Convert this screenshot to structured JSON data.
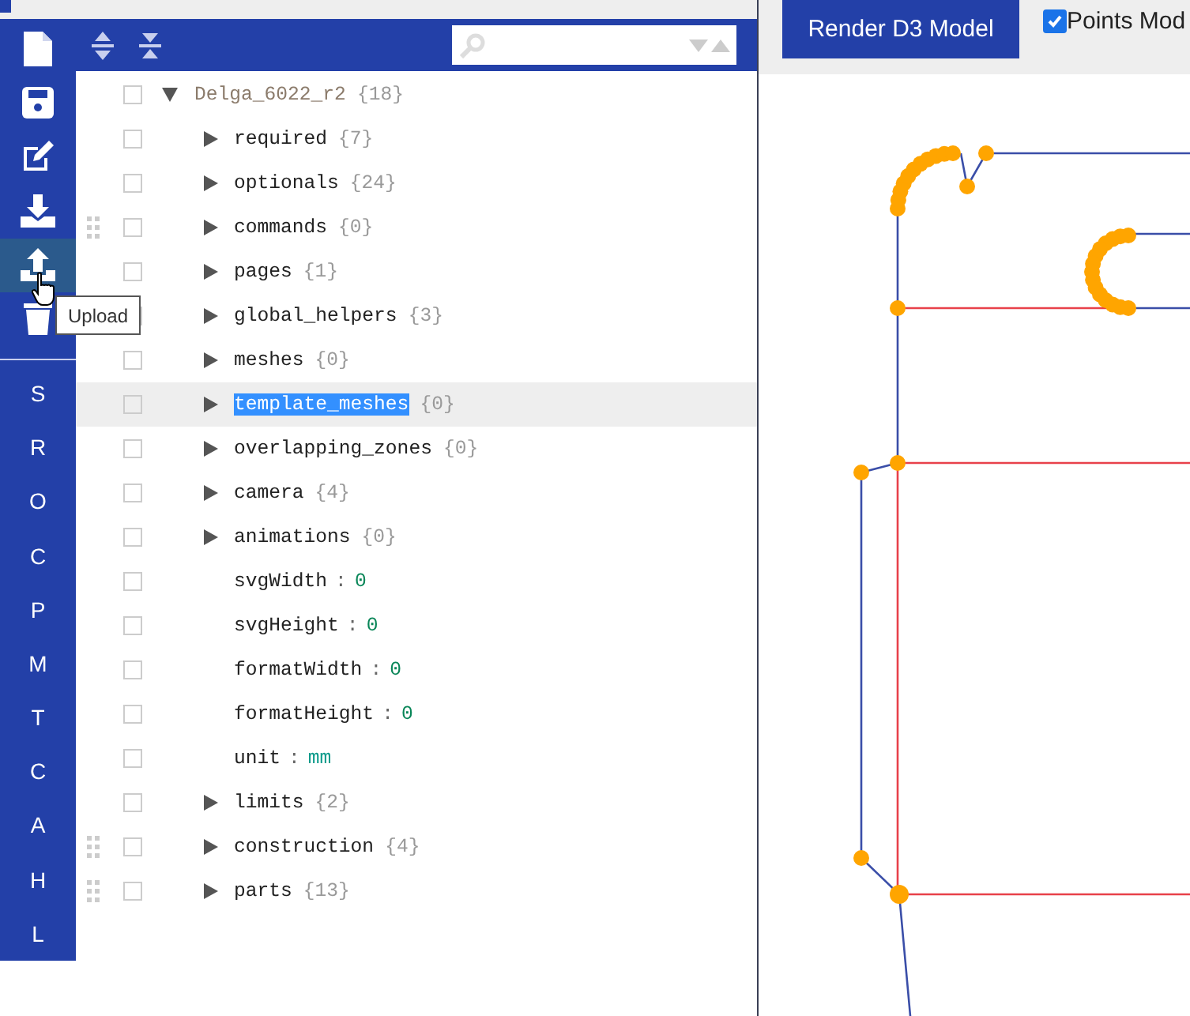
{
  "sidebar": {
    "tools": [
      {
        "kind": "file",
        "selected": false
      },
      {
        "kind": "save",
        "selected": false
      },
      {
        "kind": "edit",
        "selected": false
      },
      {
        "kind": "download",
        "selected": false
      },
      {
        "kind": "upload",
        "selected": true
      },
      {
        "kind": "trash",
        "selected": false
      }
    ],
    "tooltip": "Upload",
    "sections": [
      "S",
      "R",
      "O",
      "C",
      "P",
      "M",
      "T",
      "C",
      "A",
      "H",
      "L"
    ]
  },
  "tree": {
    "root": {
      "label": "Delga_6022_r2",
      "count": "{18}",
      "expanded": true,
      "checked": false,
      "children": [
        {
          "kind": "object",
          "key": "required",
          "count": "{7}",
          "expanded": false,
          "draggable": false,
          "checked": false,
          "selected": false
        },
        {
          "kind": "object",
          "key": "optionals",
          "count": "{24}",
          "expanded": false,
          "draggable": false,
          "checked": false,
          "selected": false
        },
        {
          "kind": "object",
          "key": "commands",
          "count": "{0}",
          "expanded": false,
          "draggable": true,
          "checked": false,
          "selected": false
        },
        {
          "kind": "object",
          "key": "pages",
          "count": "{1}",
          "expanded": false,
          "draggable": false,
          "checked": false,
          "selected": false
        },
        {
          "kind": "object",
          "key": "global_helpers",
          "count": "{3}",
          "expanded": false,
          "draggable": false,
          "checked": false,
          "selected": false
        },
        {
          "kind": "object",
          "key": "meshes",
          "count": "{0}",
          "expanded": false,
          "draggable": false,
          "checked": false,
          "selected": false
        },
        {
          "kind": "object",
          "key": "template_meshes",
          "count": "{0}",
          "expanded": false,
          "draggable": false,
          "checked": false,
          "selected": true
        },
        {
          "kind": "object",
          "key": "overlapping_zones",
          "count": "{0}",
          "expanded": false,
          "draggable": false,
          "checked": false,
          "selected": false
        },
        {
          "kind": "object",
          "key": "camera",
          "count": "{4}",
          "expanded": false,
          "draggable": false,
          "checked": false,
          "selected": false
        },
        {
          "kind": "object",
          "key": "animations",
          "count": "{0}",
          "expanded": false,
          "draggable": false,
          "checked": false,
          "selected": false
        },
        {
          "kind": "number",
          "key": "svgWidth",
          "sep": ":",
          "value": "0",
          "draggable": false,
          "checked": false,
          "selected": false
        },
        {
          "kind": "number",
          "key": "svgHeight",
          "sep": ":",
          "value": "0",
          "draggable": false,
          "checked": false,
          "selected": false
        },
        {
          "kind": "number",
          "key": "formatWidth",
          "sep": ":",
          "value": "0",
          "draggable": false,
          "checked": false,
          "selected": false
        },
        {
          "kind": "number",
          "key": "formatHeight",
          "sep": ":",
          "value": "0",
          "draggable": false,
          "checked": false,
          "selected": false
        },
        {
          "kind": "string",
          "key": "unit",
          "sep": ":",
          "value": "mm",
          "draggable": false,
          "checked": false,
          "selected": false
        },
        {
          "kind": "object",
          "key": "limits",
          "count": "{2}",
          "expanded": false,
          "draggable": false,
          "checked": false,
          "selected": false
        },
        {
          "kind": "object",
          "key": "construction",
          "count": "{4}",
          "expanded": false,
          "draggable": true,
          "checked": false,
          "selected": false
        },
        {
          "kind": "object",
          "key": "parts",
          "count": "{13}",
          "expanded": false,
          "draggable": true,
          "checked": false,
          "selected": false
        }
      ]
    }
  },
  "viewer": {
    "render_button": "Render D3 Model",
    "points_mode": {
      "label": "Points Mod",
      "checked": true
    }
  }
}
